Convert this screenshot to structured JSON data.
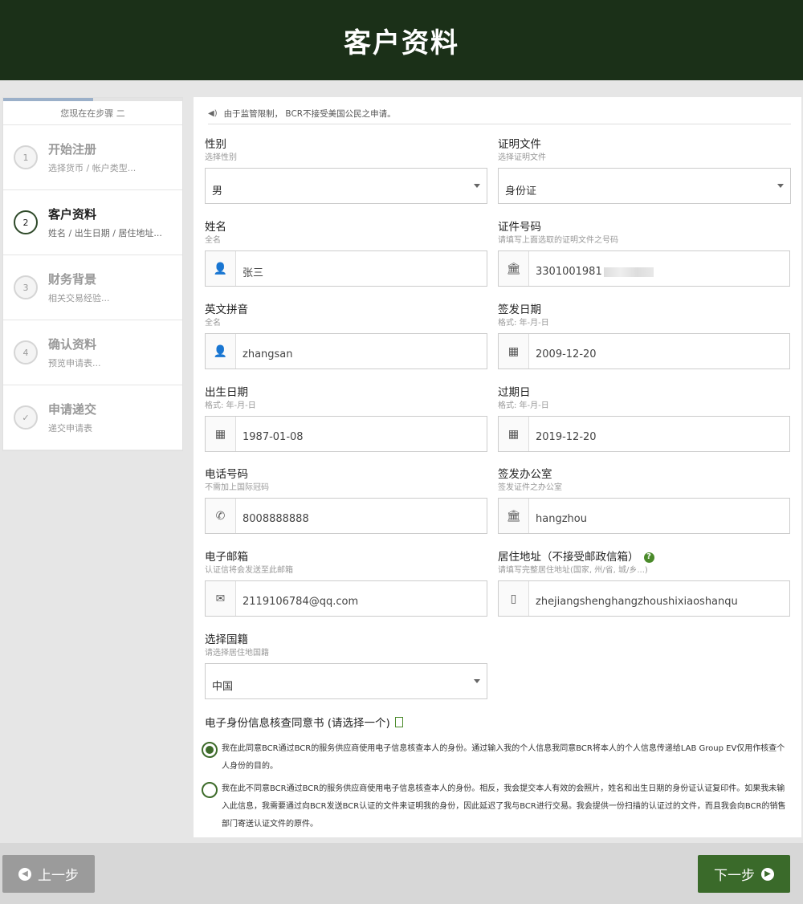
{
  "header": {
    "title": "客户资料"
  },
  "sidebar": {
    "progress": 0.5,
    "step_info": "您现在在步骤 二",
    "steps": [
      {
        "num": "1",
        "title": "开始注册",
        "sub": "选择货币 / 帐户类型..."
      },
      {
        "num": "2",
        "title": "客户资料",
        "sub": "姓名 / 出生日期 / 居住地址..."
      },
      {
        "num": "3",
        "title": "财务背景",
        "sub": "相关交易经验..."
      },
      {
        "num": "4",
        "title": "确认资料",
        "sub": "预览申请表..."
      },
      {
        "num": "✓",
        "title": "申请递交",
        "sub": "递交申请表"
      }
    ]
  },
  "notice": "由于监管限制， BCR不接受美国公民之申请。",
  "fields": {
    "gender": {
      "label": "性别",
      "hint": "选择性别",
      "value": "男"
    },
    "doc_type": {
      "label": "证明文件",
      "hint": "选择证明文件",
      "value": "身份证"
    },
    "name": {
      "label": "姓名",
      "hint": "全名",
      "value": "张三"
    },
    "doc_number": {
      "label": "证件号码",
      "hint": "请填写上面选取的证明文件之号码",
      "value": "3301001981"
    },
    "pinyin": {
      "label": "英文拼音",
      "hint": "全名",
      "value": "zhangsan"
    },
    "issue_date": {
      "label": "签发日期",
      "hint": "格式: 年-月-日",
      "value": "2009-12-20"
    },
    "birth_date": {
      "label": "出生日期",
      "hint": "格式: 年-月-日",
      "value": "1987-01-08"
    },
    "expiry_date": {
      "label": "过期日",
      "hint": "格式: 年-月-日",
      "value": "2019-12-20"
    },
    "phone": {
      "label": "电话号码",
      "hint": "不需加上国际冠码",
      "value": "8008888888"
    },
    "issue_office": {
      "label": "签发办公室",
      "hint": "签发证件之办公室",
      "value": "hangzhou"
    },
    "email": {
      "label": "电子邮箱",
      "hint": "认证信将会发送至此邮箱",
      "value": "2119106784@qq.com"
    },
    "address": {
      "label": "居住地址（不接受邮政信箱）",
      "hint": "请填写完整居住地址(国家, 州/省, 城/乡...)",
      "value": "zhejiangshenghangzhoushixiaoshanqu"
    },
    "nationality": {
      "label": "选择国籍",
      "hint": "请选择居住地国籍",
      "value": "中国"
    }
  },
  "consent": {
    "title": "电子身份信息核查同意书 (请选择一个)",
    "options": [
      "我在此同意BCR通过BCR的服务供应商使用电子信息核查本人的身份。通过输入我的个人信息我同意BCR将本人的个人信息传递给LAB Group EV仅用作核查个人身份的目的。",
      "我在此不同意BCR通过BCR的服务供应商使用电子信息核查本人的身份。相反，我会提交本人有效的会照片，姓名和出生日期的身份证认证复印件。如果我未输入此信息，我需要通过向BCR发送BCR认证的文件来证明我的身份，因此延迟了我与BCR进行交易。我会提供一份扫描的认证过的文件，而且我会向BCR的销售部门寄送认证文件的原件。"
    ],
    "selected": 0
  },
  "footer": {
    "prev": "上一步",
    "next": "下一步"
  },
  "colors": {
    "header": "#1b3018",
    "accent": "#3a6a2a",
    "prev_button": "#9b9b9b"
  }
}
